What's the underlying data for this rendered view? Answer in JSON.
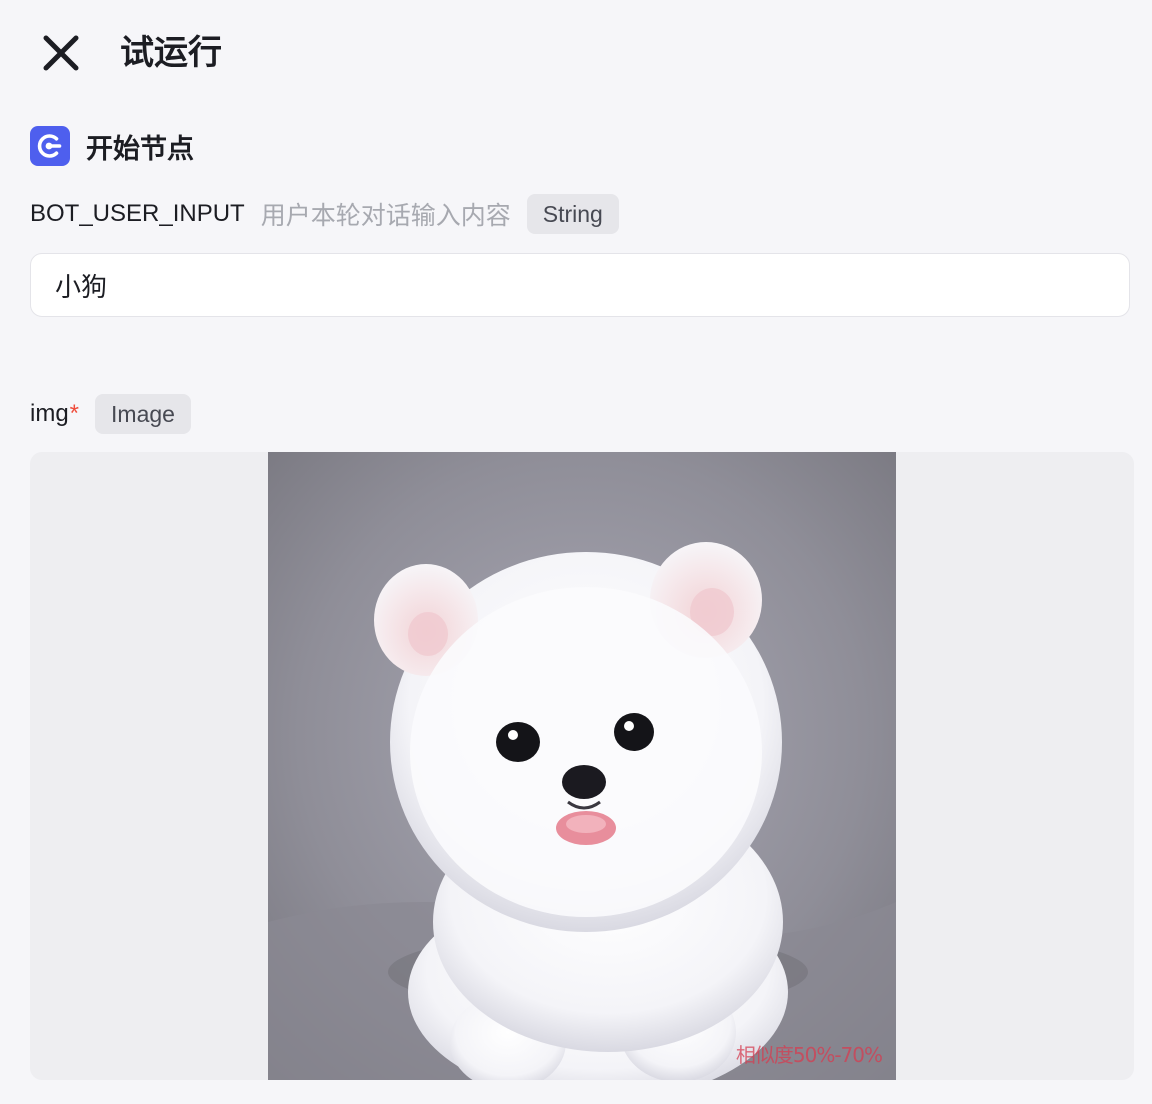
{
  "header": {
    "close_icon": "close-icon",
    "title": "试运行"
  },
  "node": {
    "icon": "start-node-icon",
    "icon_color": "#4e5fee",
    "title": "开始节点"
  },
  "fields": {
    "bot_user_input": {
      "name": "BOT_USER_INPUT",
      "description": "用户本轮对话输入内容",
      "type": "String",
      "value": "小狗"
    },
    "img": {
      "name": "img",
      "required_mark": "*",
      "type": "Image",
      "watermark_text": "相似度50%-70%"
    }
  },
  "colors": {
    "background": "#f6f6f9",
    "required": "#ef4d3c",
    "tag_bg": "#e6e6ea"
  }
}
